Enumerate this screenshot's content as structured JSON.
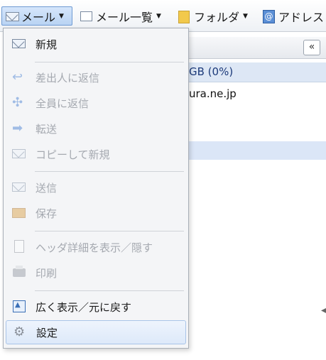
{
  "toolbar": {
    "mail_label": "メール",
    "mail_list_label": "メール一覧",
    "folder_label": "フォルダ",
    "address_label": "アドレス"
  },
  "panel": {
    "collapse_label": "«",
    "quota_text": "GB (0%)",
    "account_text": "ura.ne.jp"
  },
  "menu": {
    "new": "新規",
    "reply_sender": "差出人に返信",
    "reply_all": "全員に返信",
    "forward": "転送",
    "copy_new": "コピーして新規",
    "send": "送信",
    "save": "保存",
    "header_detail": "ヘッダ詳細を表示／隠す",
    "print": "印刷",
    "wide_view": "広く表示／元に戻す",
    "settings": "設定"
  },
  "icons": {
    "mail": "envelope-icon",
    "mail_list": "list-icon",
    "folder": "folder-icon",
    "address": "address-book-icon",
    "new": "envelope-icon",
    "reply_sender": "reply-icon",
    "reply_all": "reply-all-icon",
    "forward": "forward-icon",
    "copy_new": "copy-envelope-icon",
    "send": "send-icon",
    "save": "save-icon",
    "header_detail": "document-icon",
    "print": "printer-icon",
    "wide_view": "expand-icon",
    "settings": "gear-icon"
  }
}
